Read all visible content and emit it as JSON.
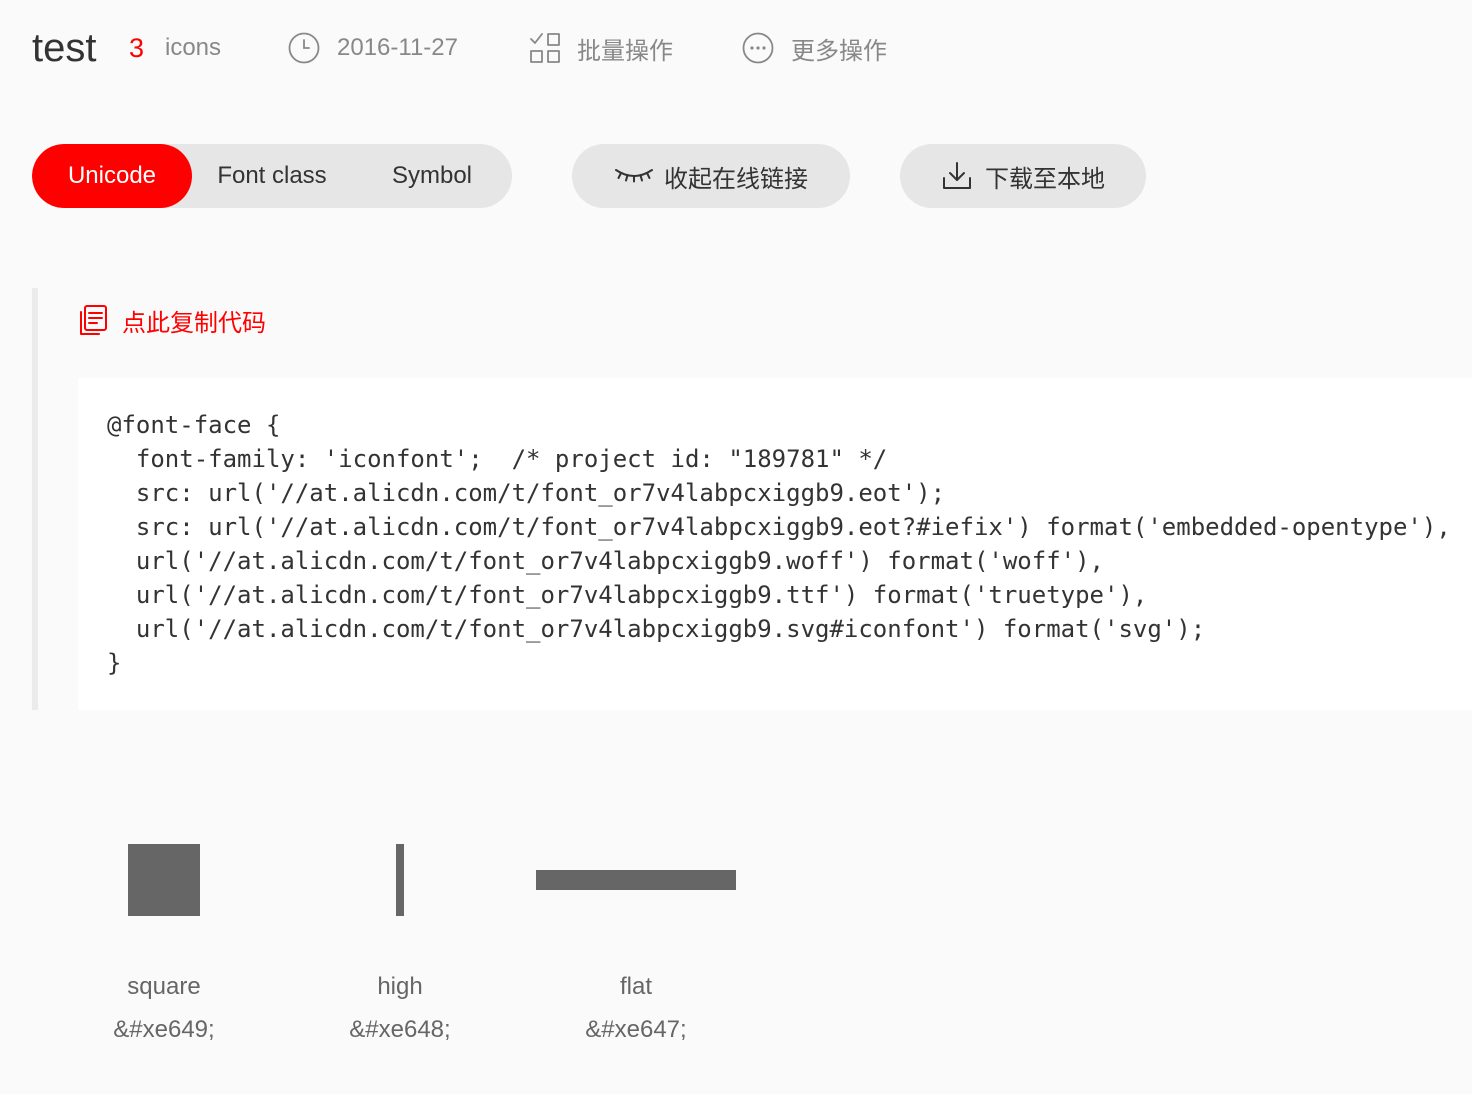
{
  "header": {
    "project_name": "test",
    "icon_count": "3",
    "icon_count_label": "icons",
    "date_icon": "clock-icon",
    "date": "2016-11-27",
    "batch_icon": "batch-grid-icon",
    "batch_label": "批量操作",
    "more_icon": "more-dots-icon",
    "more_label": "更多操作"
  },
  "tabs": [
    {
      "label": "Unicode",
      "active": true
    },
    {
      "label": "Font class",
      "active": false
    },
    {
      "label": "Symbol",
      "active": false
    }
  ],
  "actions": {
    "collapse_link_icon": "eye-closed-icon",
    "collapse_link_label": "收起在线链接",
    "download_icon": "download-icon",
    "download_label": "下载至本地"
  },
  "code": {
    "copy_icon": "copy-icon",
    "copy_label": "点此复制代码",
    "lines": [
      "@font-face {",
      "  font-family: 'iconfont';  /* project id: \"189781\" */",
      "  src: url('//at.alicdn.com/t/font_or7v4labpcxiggb9.eot');",
      "  src: url('//at.alicdn.com/t/font_or7v4labpcxiggb9.eot?#iefix') format('embedded-opentype'),",
      "  url('//at.alicdn.com/t/font_or7v4labpcxiggb9.woff') format('woff'),",
      "  url('//at.alicdn.com/t/font_or7v4labpcxiggb9.ttf') format('truetype'),",
      "  url('//at.alicdn.com/t/font_or7v4labpcxiggb9.svg#iconfont') format('svg');",
      "}"
    ]
  },
  "icons": [
    {
      "name": "square",
      "code": "&#xe649;",
      "icon": "square-glyph-icon"
    },
    {
      "name": "high",
      "code": "&#xe648;",
      "icon": "high-bar-glyph-icon"
    },
    {
      "name": "flat",
      "code": "&#xe647;",
      "icon": "flat-bar-glyph-icon"
    }
  ],
  "colors": {
    "accent": "#ff0000",
    "text": "#333333",
    "muted": "#888888",
    "pill_bg": "#e6e6e6",
    "glyph": "#666666",
    "label": "#666666",
    "page_bg": "#fafafa",
    "code_bg": "#ffffff",
    "rule": "#ebebeb"
  }
}
